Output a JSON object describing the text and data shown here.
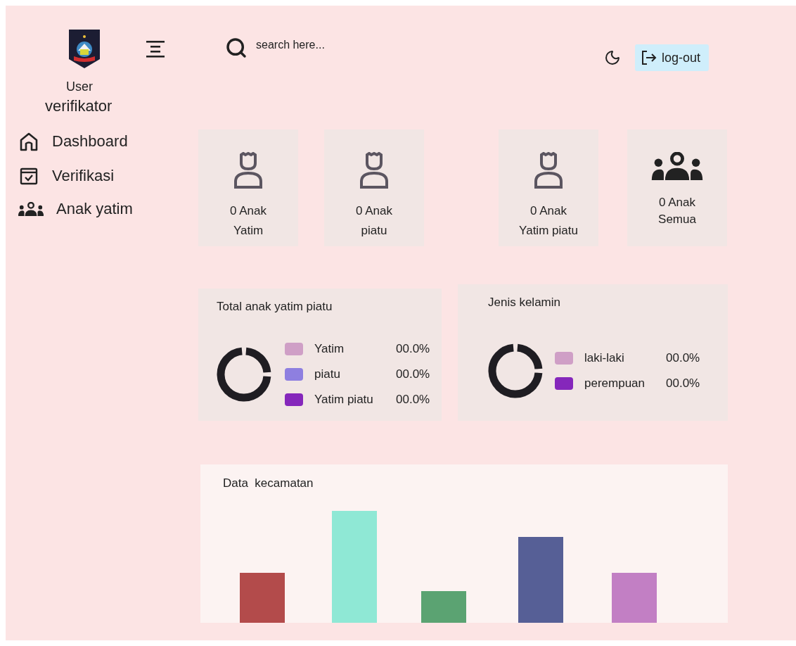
{
  "sidebar": {
    "user_role": "User",
    "user_name": "verifikator",
    "nav": [
      {
        "label": "Dashboard",
        "kind": "home"
      },
      {
        "label": "Verifikasi",
        "kind": "check"
      },
      {
        "label": "Anak yatim",
        "kind": "group"
      }
    ]
  },
  "header": {
    "search": {
      "placeholder": "search here..."
    },
    "logout": "log-out"
  },
  "stats": [
    {
      "count": "0 Anak",
      "label": "Yatim",
      "kind": "person"
    },
    {
      "count": "0 Anak",
      "label": "piatu",
      "kind": "person"
    },
    {
      "count": "0 Anak",
      "label": "Yatim piatu",
      "kind": "person"
    },
    {
      "count": "0 Anak",
      "label": "Semua",
      "kind": "group"
    }
  ],
  "donut_cards": [
    {
      "title": "Total anak yatim piatu",
      "legend": [
        {
          "label": "Yatim",
          "value": "00.0%",
          "color": "#cf9fc6"
        },
        {
          "label": "piatu",
          "value": "00.0%",
          "color": "#8e7fe0"
        },
        {
          "label": "Yatim piatu",
          "value": "00.0%",
          "color": "#8527bb"
        }
      ]
    },
    {
      "title": "Jenis kelamin",
      "legend": [
        {
          "label": "laki-laki",
          "value": "00.0%",
          "color": "#cf9fc6"
        },
        {
          "label": "perempuan",
          "value": "00.0%",
          "color": "#8527bb"
        }
      ]
    }
  ],
  "bar_card": {
    "title": "Data  kecamatan"
  }
}
